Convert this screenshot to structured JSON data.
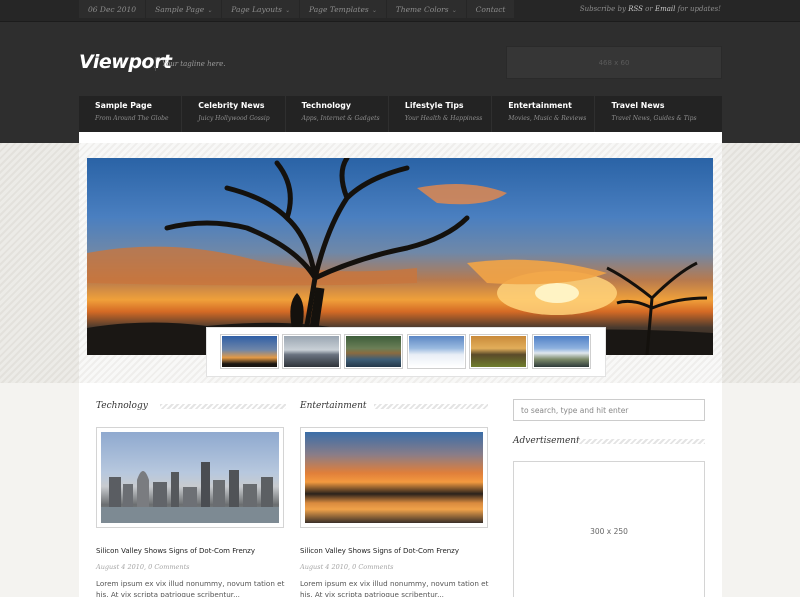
{
  "topbar": {
    "date": "06 Dec 2010",
    "items": [
      {
        "label": "Sample Page",
        "dropdown": true
      },
      {
        "label": "Page Layouts",
        "dropdown": true
      },
      {
        "label": "Page Templates",
        "dropdown": true
      },
      {
        "label": "Theme Colors",
        "dropdown": true
      },
      {
        "label": "Contact",
        "dropdown": false
      }
    ],
    "subscribe_prefix": "Subscribe by",
    "subscribe_rss": "RSS",
    "subscribe_or": "or",
    "subscribe_email": "Email",
    "subscribe_suffix": "for updates!"
  },
  "header": {
    "logo": "Viewport",
    "tagline": "Your tagline here.",
    "banner": "468 x 60"
  },
  "nav": [
    {
      "title": "Sample Page",
      "sub": "From Around The Globe"
    },
    {
      "title": "Celebrity News",
      "sub": "Juicy Hollywood Gossip"
    },
    {
      "title": "Technology",
      "sub": "Apps, Internet & Gadgets"
    },
    {
      "title": "Lifestyle Tips",
      "sub": "Your Health & Happiness"
    },
    {
      "title": "Entertainment",
      "sub": "Movies, Music & Reviews"
    },
    {
      "title": "Travel News",
      "sub": "Travel News, Guides & Tips"
    }
  ],
  "slider": {
    "thumbnails": [
      "sunset-tree",
      "rocky-shore",
      "lake-cabin",
      "snowy-trees",
      "field-barn",
      "coast-cliffs"
    ]
  },
  "columns": [
    {
      "heading": "Technology",
      "post_title": "Silicon Valley Shows Signs of Dot-Com Frenzy",
      "meta": "August 4 2010, 0 Comments",
      "excerpt": "Lorem ipsum ex vix illud nonummy, novum tation et his. At vix scripta patrioque scribentur..."
    },
    {
      "heading": "Entertainment",
      "post_title": "Silicon Valley Shows Signs of Dot-Com Frenzy",
      "meta": "August 4 2010, 0 Comments",
      "excerpt": "Lorem ipsum ex vix illud nonummy, novum tation et his. At vix scripta patrioque scribentur..."
    }
  ],
  "sidebar": {
    "search_placeholder": "to search, type and hit enter",
    "ad_heading": "Advertisement",
    "ad_size": "300 x 250"
  }
}
